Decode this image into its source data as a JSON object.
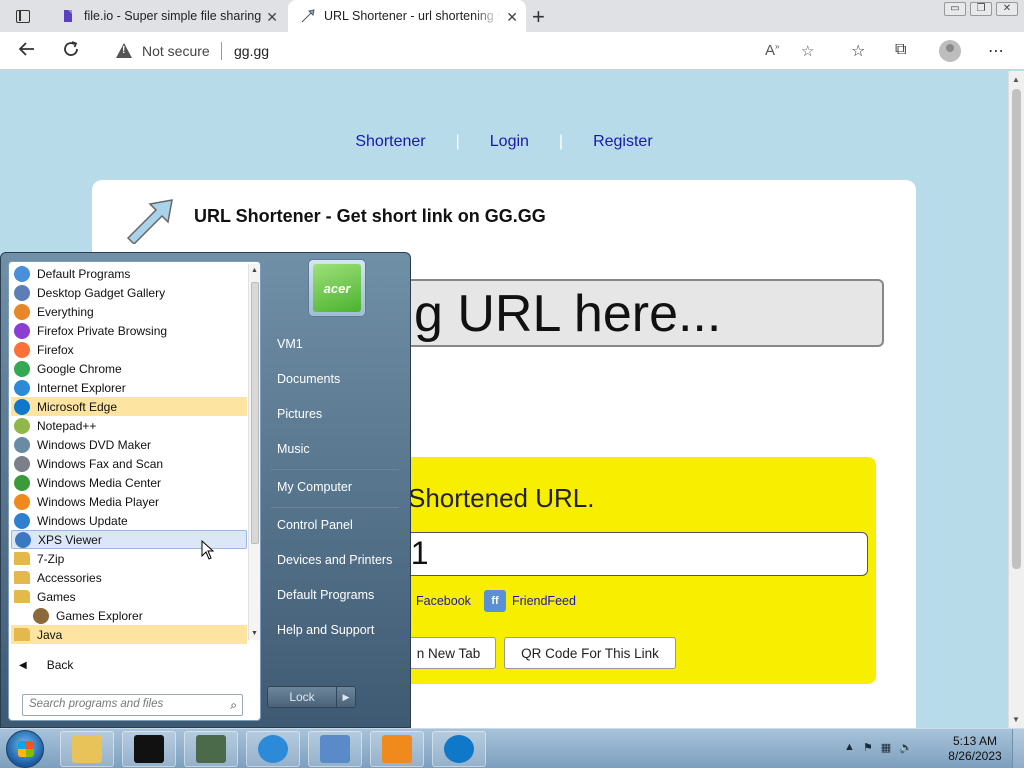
{
  "browser": {
    "tabs": [
      {
        "title": "file.io - Super simple file sharing",
        "active": false,
        "icon": "file-io-icon"
      },
      {
        "title": "URL Shortener - url shortening s",
        "active": true,
        "icon": "arrow-icon"
      }
    ],
    "new_tab_glyph": "+",
    "security_text": "Not secure",
    "url": "gg.gg",
    "window_buttons": [
      "▭",
      "❐",
      "✕"
    ]
  },
  "page": {
    "nav": [
      "Shortener",
      "Login",
      "Register"
    ],
    "title": "URL Shortener - Get short link on GG.GG",
    "long_url_placeholder": "g URL here...",
    "shortened_label": "Shortened URL.",
    "short_url_value": "41",
    "share": [
      {
        "label": "Facebook",
        "icon": "facebook-icon",
        "badge": "f"
      },
      {
        "label": "FriendFeed",
        "icon": "friendfeed-icon",
        "badge": "ff"
      }
    ],
    "buttons": [
      "n New Tab",
      "QR Code For This Link"
    ],
    "colors": {
      "background": "#b7dbe8",
      "result_box": "#f7ee00",
      "link": "#1a1aaa"
    }
  },
  "startmenu": {
    "programs": [
      {
        "label": "Default Programs",
        "color": "#4a8fd9",
        "state": "",
        "type": "app"
      },
      {
        "label": "Desktop Gadget Gallery",
        "color": "#5b7fb5",
        "state": "",
        "type": "app"
      },
      {
        "label": "Everything",
        "color": "#e8862a",
        "state": "",
        "type": "app"
      },
      {
        "label": "Firefox Private Browsing",
        "color": "#8a3fd1",
        "state": "",
        "type": "app"
      },
      {
        "label": "Firefox",
        "color": "#ff7139",
        "state": "",
        "type": "app"
      },
      {
        "label": "Google Chrome",
        "color": "#34a853",
        "state": "",
        "type": "app"
      },
      {
        "label": "Internet Explorer",
        "color": "#2c8ad8",
        "state": "",
        "type": "app"
      },
      {
        "label": "Microsoft Edge",
        "color": "#0f78c8",
        "state": "hl",
        "type": "app"
      },
      {
        "label": "Notepad++",
        "color": "#8fb84a",
        "state": "",
        "type": "app"
      },
      {
        "label": "Windows DVD Maker",
        "color": "#6a8aa5",
        "state": "",
        "type": "app"
      },
      {
        "label": "Windows Fax and Scan",
        "color": "#7a7f88",
        "state": "",
        "type": "app"
      },
      {
        "label": "Windows Media Center",
        "color": "#3b9b3b",
        "state": "",
        "type": "app"
      },
      {
        "label": "Windows Media Player",
        "color": "#f08a1c",
        "state": "",
        "type": "app"
      },
      {
        "label": "Windows Update",
        "color": "#2f7fcf",
        "state": "",
        "type": "app"
      },
      {
        "label": "XPS Viewer",
        "color": "#3a78c2",
        "state": "sel",
        "type": "app"
      },
      {
        "label": "7-Zip",
        "color": "#e4b84a",
        "state": "",
        "type": "folder"
      },
      {
        "label": "Accessories",
        "color": "#e4b84a",
        "state": "",
        "type": "folder"
      },
      {
        "label": "Games",
        "color": "#e4b84a",
        "state": "",
        "type": "folder"
      },
      {
        "label": "Games Explorer",
        "color": "#8a6a3a",
        "state": "sub",
        "type": "app"
      },
      {
        "label": "Java",
        "color": "#e4b84a",
        "state": "hl",
        "type": "folder"
      }
    ],
    "back_label": "Back",
    "search_placeholder": "Search programs and files",
    "user_logo_text": "acer",
    "right_links": [
      "VM1",
      "Documents",
      "Pictures",
      "Music",
      "My Computer",
      "Control Panel",
      "Devices and Printers",
      "Default Programs",
      "Help and Support"
    ],
    "lock_label": "Lock"
  },
  "taskbar": {
    "apps": [
      {
        "name": "windows-explorer",
        "color": "#e8c35a"
      },
      {
        "name": "7zip",
        "color": "#111111"
      },
      {
        "name": "network-monitor",
        "color": "#4a6a4a"
      },
      {
        "name": "internet-explorer",
        "color": "#2c8ad8"
      },
      {
        "name": "remote-desktop",
        "color": "#5a8bc8"
      },
      {
        "name": "media-player",
        "color": "#f08a1c"
      },
      {
        "name": "microsoft-edge",
        "color": "#0f78c8"
      }
    ],
    "time": "5:13 AM",
    "date": "8/26/2023"
  }
}
